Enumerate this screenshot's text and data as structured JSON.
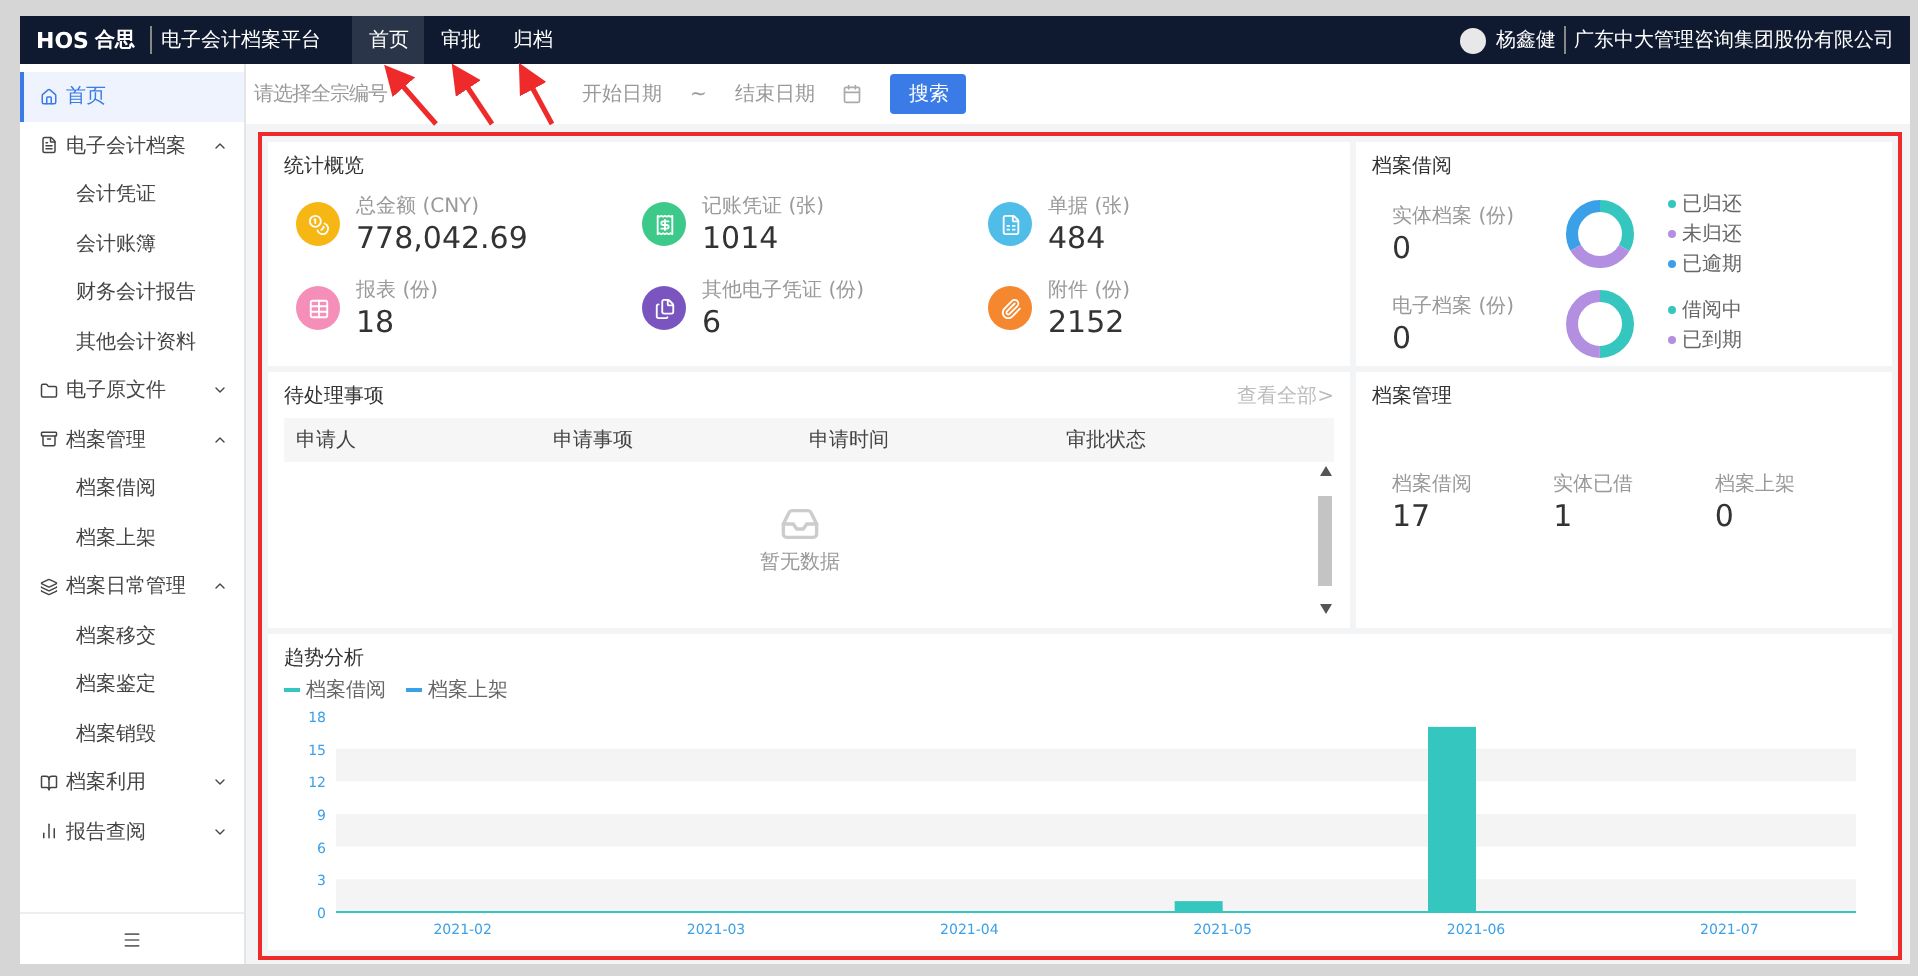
{
  "header": {
    "logo": "HOS",
    "brand": "合思",
    "product": "电子会计档案平台",
    "tabs": [
      {
        "label": "首页",
        "selected": true
      },
      {
        "label": "审批",
        "selected": false
      },
      {
        "label": "归档",
        "selected": false
      }
    ],
    "user": "杨鑫健",
    "company": "广东中大管理咨询集团股份有限公司"
  },
  "sidebar": {
    "items": [
      {
        "kind": "link",
        "label": "首页",
        "selected": true
      },
      {
        "kind": "group",
        "label": "电子会计档案",
        "expanded": true,
        "children": [
          {
            "label": "会计凭证",
            "selected": false
          },
          {
            "label": "会计账簿",
            "selected": false
          },
          {
            "label": "财务会计报告",
            "selected": false
          },
          {
            "label": "其他会计资料",
            "selected": false
          }
        ]
      },
      {
        "kind": "group",
        "label": "电子原文件",
        "expanded": false
      },
      {
        "kind": "group",
        "label": "档案管理",
        "expanded": true,
        "children": [
          {
            "label": "档案借阅",
            "selected": false
          },
          {
            "label": "档案上架",
            "selected": false
          }
        ]
      },
      {
        "kind": "group",
        "label": "档案日常管理",
        "expanded": true,
        "children": [
          {
            "label": "档案移交",
            "selected": false
          },
          {
            "label": "档案鉴定",
            "selected": false
          },
          {
            "label": "档案销毁",
            "selected": false
          }
        ]
      },
      {
        "kind": "group",
        "label": "档案利用",
        "expanded": false
      },
      {
        "kind": "group",
        "label": "报告查阅",
        "expanded": false
      }
    ]
  },
  "filters": {
    "fund_placeholder": "请选择全宗编号",
    "start_placeholder": "开始日期",
    "separator": "~",
    "end_placeholder": "结束日期",
    "search_button": "搜索"
  },
  "stats": {
    "title": "统计概览",
    "items": [
      {
        "label": "总金额",
        "unit": "(CNY)",
        "value": "778,042.69",
        "color": "#f6b614"
      },
      {
        "label": "记账凭证",
        "unit": "(张)",
        "value": "1014",
        "color": "#3cc98a"
      },
      {
        "label": "单据",
        "unit": "(张)",
        "value": "484",
        "color": "#4fbde8"
      },
      {
        "label": "报表",
        "unit": "(份)",
        "value": "18",
        "color": "#f58fba"
      },
      {
        "label": "其他电子凭证",
        "unit": "(份)",
        "value": "6",
        "color": "#7a55c0"
      },
      {
        "label": "附件",
        "unit": "(份)",
        "value": "2152",
        "color": "#f5882f"
      }
    ]
  },
  "borrow": {
    "title": "档案借阅",
    "groups": [
      {
        "label": "实体档案",
        "unit": "(份)",
        "value": "0",
        "legend": [
          {
            "label": "已归还",
            "color": "#36c6c0"
          },
          {
            "label": "未归还",
            "color": "#b28fe0"
          },
          {
            "label": "已逾期",
            "color": "#3aa0e8"
          }
        ]
      },
      {
        "label": "电子档案",
        "unit": "(份)",
        "value": "0",
        "legend": [
          {
            "label": "借阅中",
            "color": "#36c6c0"
          },
          {
            "label": "已到期",
            "color": "#b28fe0"
          }
        ]
      }
    ]
  },
  "todo": {
    "title": "待处理事项",
    "link": "查看全部>",
    "columns": [
      "申请人",
      "申请事项",
      "申请时间",
      "审批状态"
    ],
    "empty": "暂无数据"
  },
  "manage": {
    "title": "档案管理",
    "items": [
      {
        "label": "档案借阅",
        "value": "17"
      },
      {
        "label": "实体已借",
        "value": "1"
      },
      {
        "label": "档案上架",
        "value": "0"
      }
    ]
  },
  "trend": {
    "title": "趋势分析",
    "chart_data": {
      "type": "bar",
      "categories": [
        "2021-02",
        "2021-03",
        "2021-04",
        "2021-05",
        "2021-06",
        "2021-07"
      ],
      "series": [
        {
          "name": "档案借阅",
          "color": "#36c6c0",
          "values": [
            0,
            0,
            0,
            1,
            17,
            0
          ]
        },
        {
          "name": "档案上架",
          "color": "#3aa0e8",
          "values": [
            0,
            0,
            0,
            0,
            0,
            0
          ]
        }
      ],
      "ylim": [
        0,
        18
      ],
      "yticks": [
        0,
        3,
        6,
        9,
        12,
        15,
        18
      ]
    }
  }
}
